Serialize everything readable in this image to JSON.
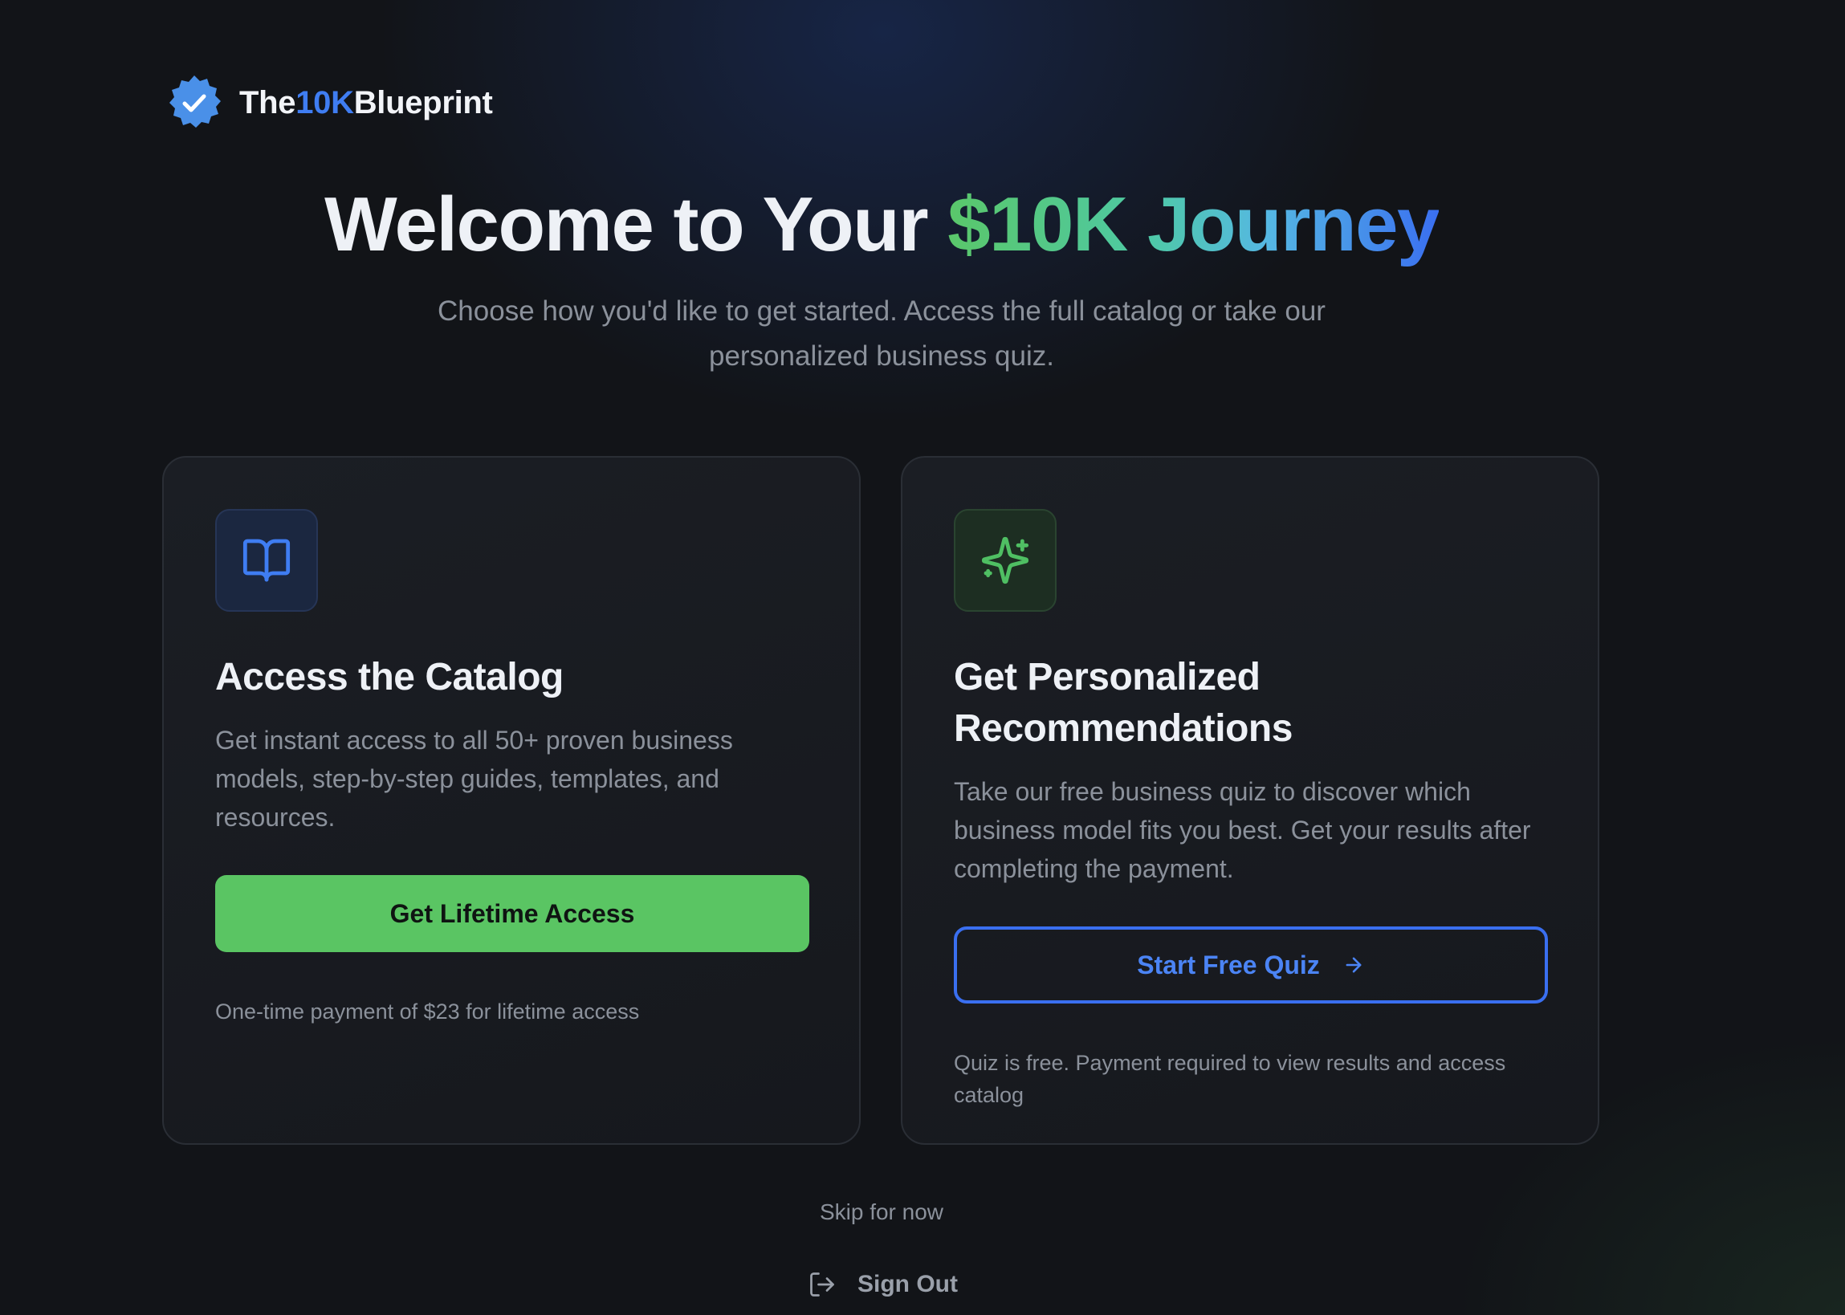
{
  "brand": {
    "prefix": "The",
    "accent": "10K",
    "suffix": "Blueprint",
    "badge_icon": "verified-badge-icon",
    "accent_color": "#3f7df2"
  },
  "hero": {
    "title_plain": "Welcome to Your ",
    "title_highlight": "$10K Journey",
    "subtitle": "Choose how you'd like to get started. Access the full catalog or take our personalized business quiz."
  },
  "cards": [
    {
      "icon": "book-open-icon",
      "title": "Access the Catalog",
      "description": "Get instant access to all 50+ proven business models, step-by-step guides, templates, and resources.",
      "button_label": "Get Lifetime Access",
      "note": "One-time payment of $23 for lifetime access"
    },
    {
      "icon": "sparkles-icon",
      "title": "Get Personalized Recommendations",
      "description": "Take our free business quiz to discover which business model fits you best. Get your results after completing the payment.",
      "button_label": "Start Free Quiz",
      "button_icon": "arrow-right-icon",
      "note": "Quiz is free. Payment required to view results and access catalog"
    }
  ],
  "footer": {
    "skip_label": "Skip for now",
    "signout_label": "Sign Out",
    "signout_icon": "log-out-icon"
  },
  "colors": {
    "primary_green": "#5ac563",
    "primary_blue": "#3a6ff0",
    "background": "#121418"
  }
}
